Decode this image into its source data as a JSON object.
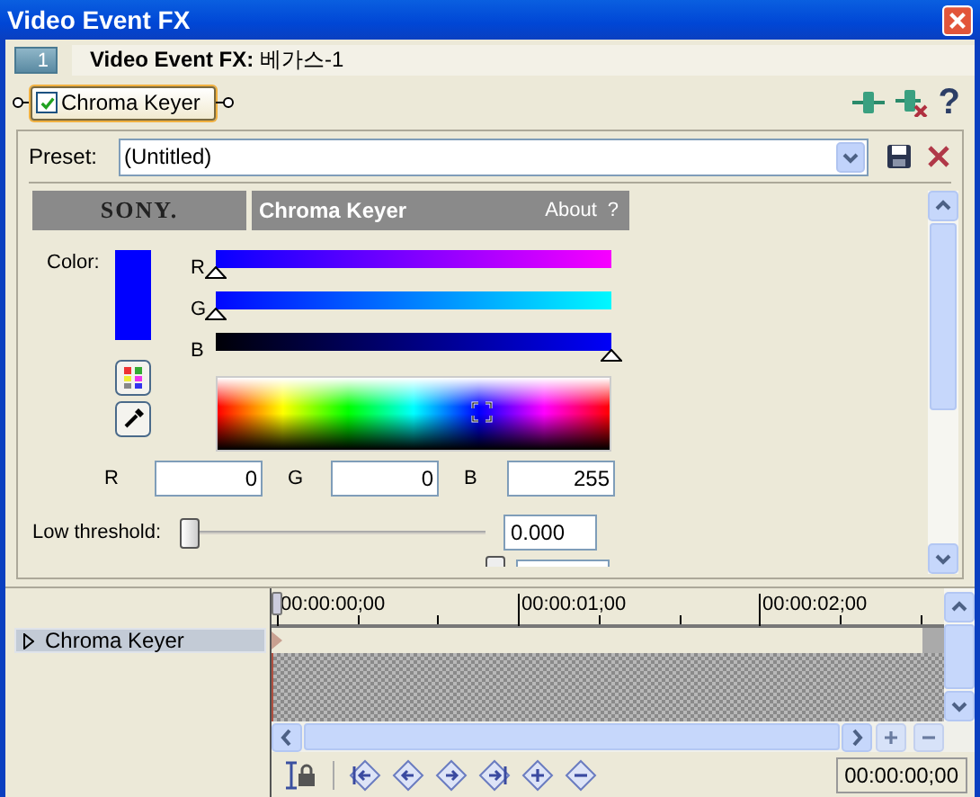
{
  "window": {
    "title": "Video Event FX"
  },
  "chain": {
    "index": "1",
    "title": "**Video Event FX:** 베가스-1",
    "help": "?"
  },
  "plugin": {
    "label": "Chroma Keyer",
    "enabled": true
  },
  "preset": {
    "label": "Preset:",
    "value": "(Untitled)"
  },
  "header": {
    "brand": "SONY.",
    "name": "Chroma Keyer",
    "about": "About",
    "help": "?"
  },
  "color": {
    "label": "Color:",
    "sliders": [
      {
        "label": "R",
        "level": 0
      },
      {
        "label": "G",
        "level": 0
      },
      {
        "label": "B",
        "level": 1
      }
    ],
    "fields": [
      {
        "label": "R",
        "value": "0"
      },
      {
        "label": "G",
        "value": "0"
      },
      {
        "label": "B",
        "value": "255"
      }
    ]
  },
  "low_threshold": {
    "label": "Low threshold:",
    "level": 0,
    "value": "0.000"
  },
  "timeline": {
    "tracks": [
      {
        "label": "Chroma Keyer",
        "selected": true
      }
    ],
    "ruler": [
      "00:00:00;00",
      "00:00:01;00",
      "00:00:02;00"
    ],
    "time": "00:00:00;00"
  }
}
